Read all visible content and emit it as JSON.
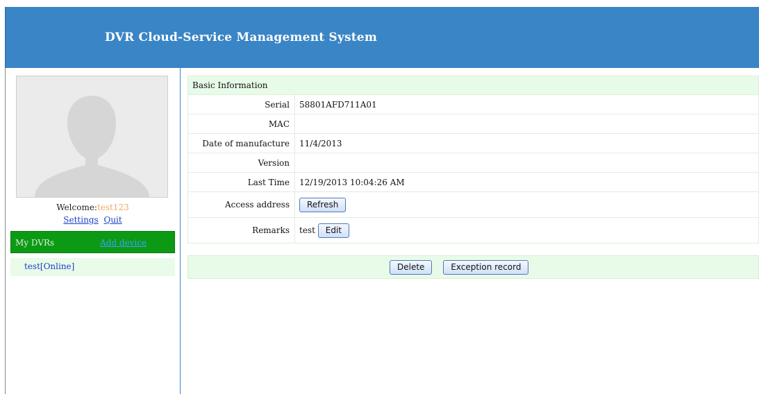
{
  "header": {
    "title": "DVR Cloud-Service Management System"
  },
  "sidebar": {
    "welcome_label": "Welcome:",
    "username": "test123",
    "settings_link": "Settings",
    "quit_link": "Quit",
    "dvr_section_label": "My DVRs",
    "add_device_link": "Add device",
    "devices": [
      {
        "label": "test[Online]"
      }
    ]
  },
  "info": {
    "section_title": "Basic Information",
    "rows": [
      {
        "label": "Serial",
        "value": "58801AFD711A01"
      },
      {
        "label": "MAC",
        "value": ""
      },
      {
        "label": "Date of manufacture",
        "value": "11/4/2013"
      },
      {
        "label": "Version",
        "value": ""
      },
      {
        "label": "Last Time",
        "value": "12/19/2013 10:04:26 AM"
      },
      {
        "label": "Access address",
        "button": "Refresh"
      },
      {
        "label": "Remarks",
        "value": "test",
        "button": "Edit"
      }
    ]
  },
  "actions": {
    "delete_label": "Delete",
    "exception_label": "Exception record"
  },
  "colors": {
    "header_bg": "#3a85c6",
    "dvr_bar": "#0c9a14",
    "row_highlight": "#e8fbe8"
  }
}
